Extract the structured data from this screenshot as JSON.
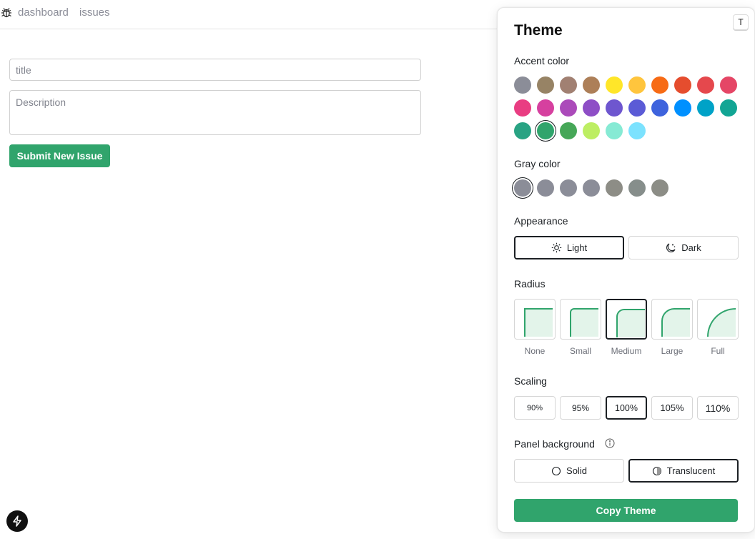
{
  "nav": {
    "dashboard": "dashboard",
    "issues": "issues"
  },
  "form": {
    "title_placeholder": "title",
    "description_placeholder": "Description",
    "submit_label": "Submit New Issue"
  },
  "theme_panel": {
    "title": "Theme",
    "shortcut_key": "T",
    "accent_label": "Accent color",
    "accent_colors": [
      "#8b8d98",
      "#978365",
      "#a18072",
      "#ad7f58",
      "#ffe629",
      "#ffc53d",
      "#f76b15",
      "#e54d2e",
      "#e5484d",
      "#e54666",
      "#e93d82",
      "#d6409f",
      "#ab4aba",
      "#8e4ec6",
      "#6e56cf",
      "#5b5bd6",
      "#3e63dd",
      "#0090ff",
      "#00a2c7",
      "#12a594",
      "#29a383",
      "#30a46c",
      "#46a758",
      "#bdee63",
      "#86ead4",
      "#7ce2fe"
    ],
    "accent_selected": 21,
    "gray_label": "Gray color",
    "gray_colors": [
      "#8b8d98",
      "#8b8d98",
      "#8b8d98",
      "#8b8d98",
      "#8d8d86",
      "#868e8b",
      "#8c8d86"
    ],
    "gray_selected": 0,
    "appearance_label": "Appearance",
    "appearance_light": "Light",
    "appearance_dark": "Dark",
    "radius_label": "Radius",
    "radius_options": [
      "None",
      "Small",
      "Medium",
      "Large",
      "Full"
    ],
    "radius_selected": "Medium",
    "scaling_label": "Scaling",
    "scaling_options": [
      "90%",
      "95%",
      "100%",
      "105%",
      "110%"
    ],
    "scaling_selected": "100%",
    "panel_bg_label": "Panel background",
    "panel_bg_solid": "Solid",
    "panel_bg_translucent": "Translucent",
    "copy_label": "Copy Theme"
  }
}
